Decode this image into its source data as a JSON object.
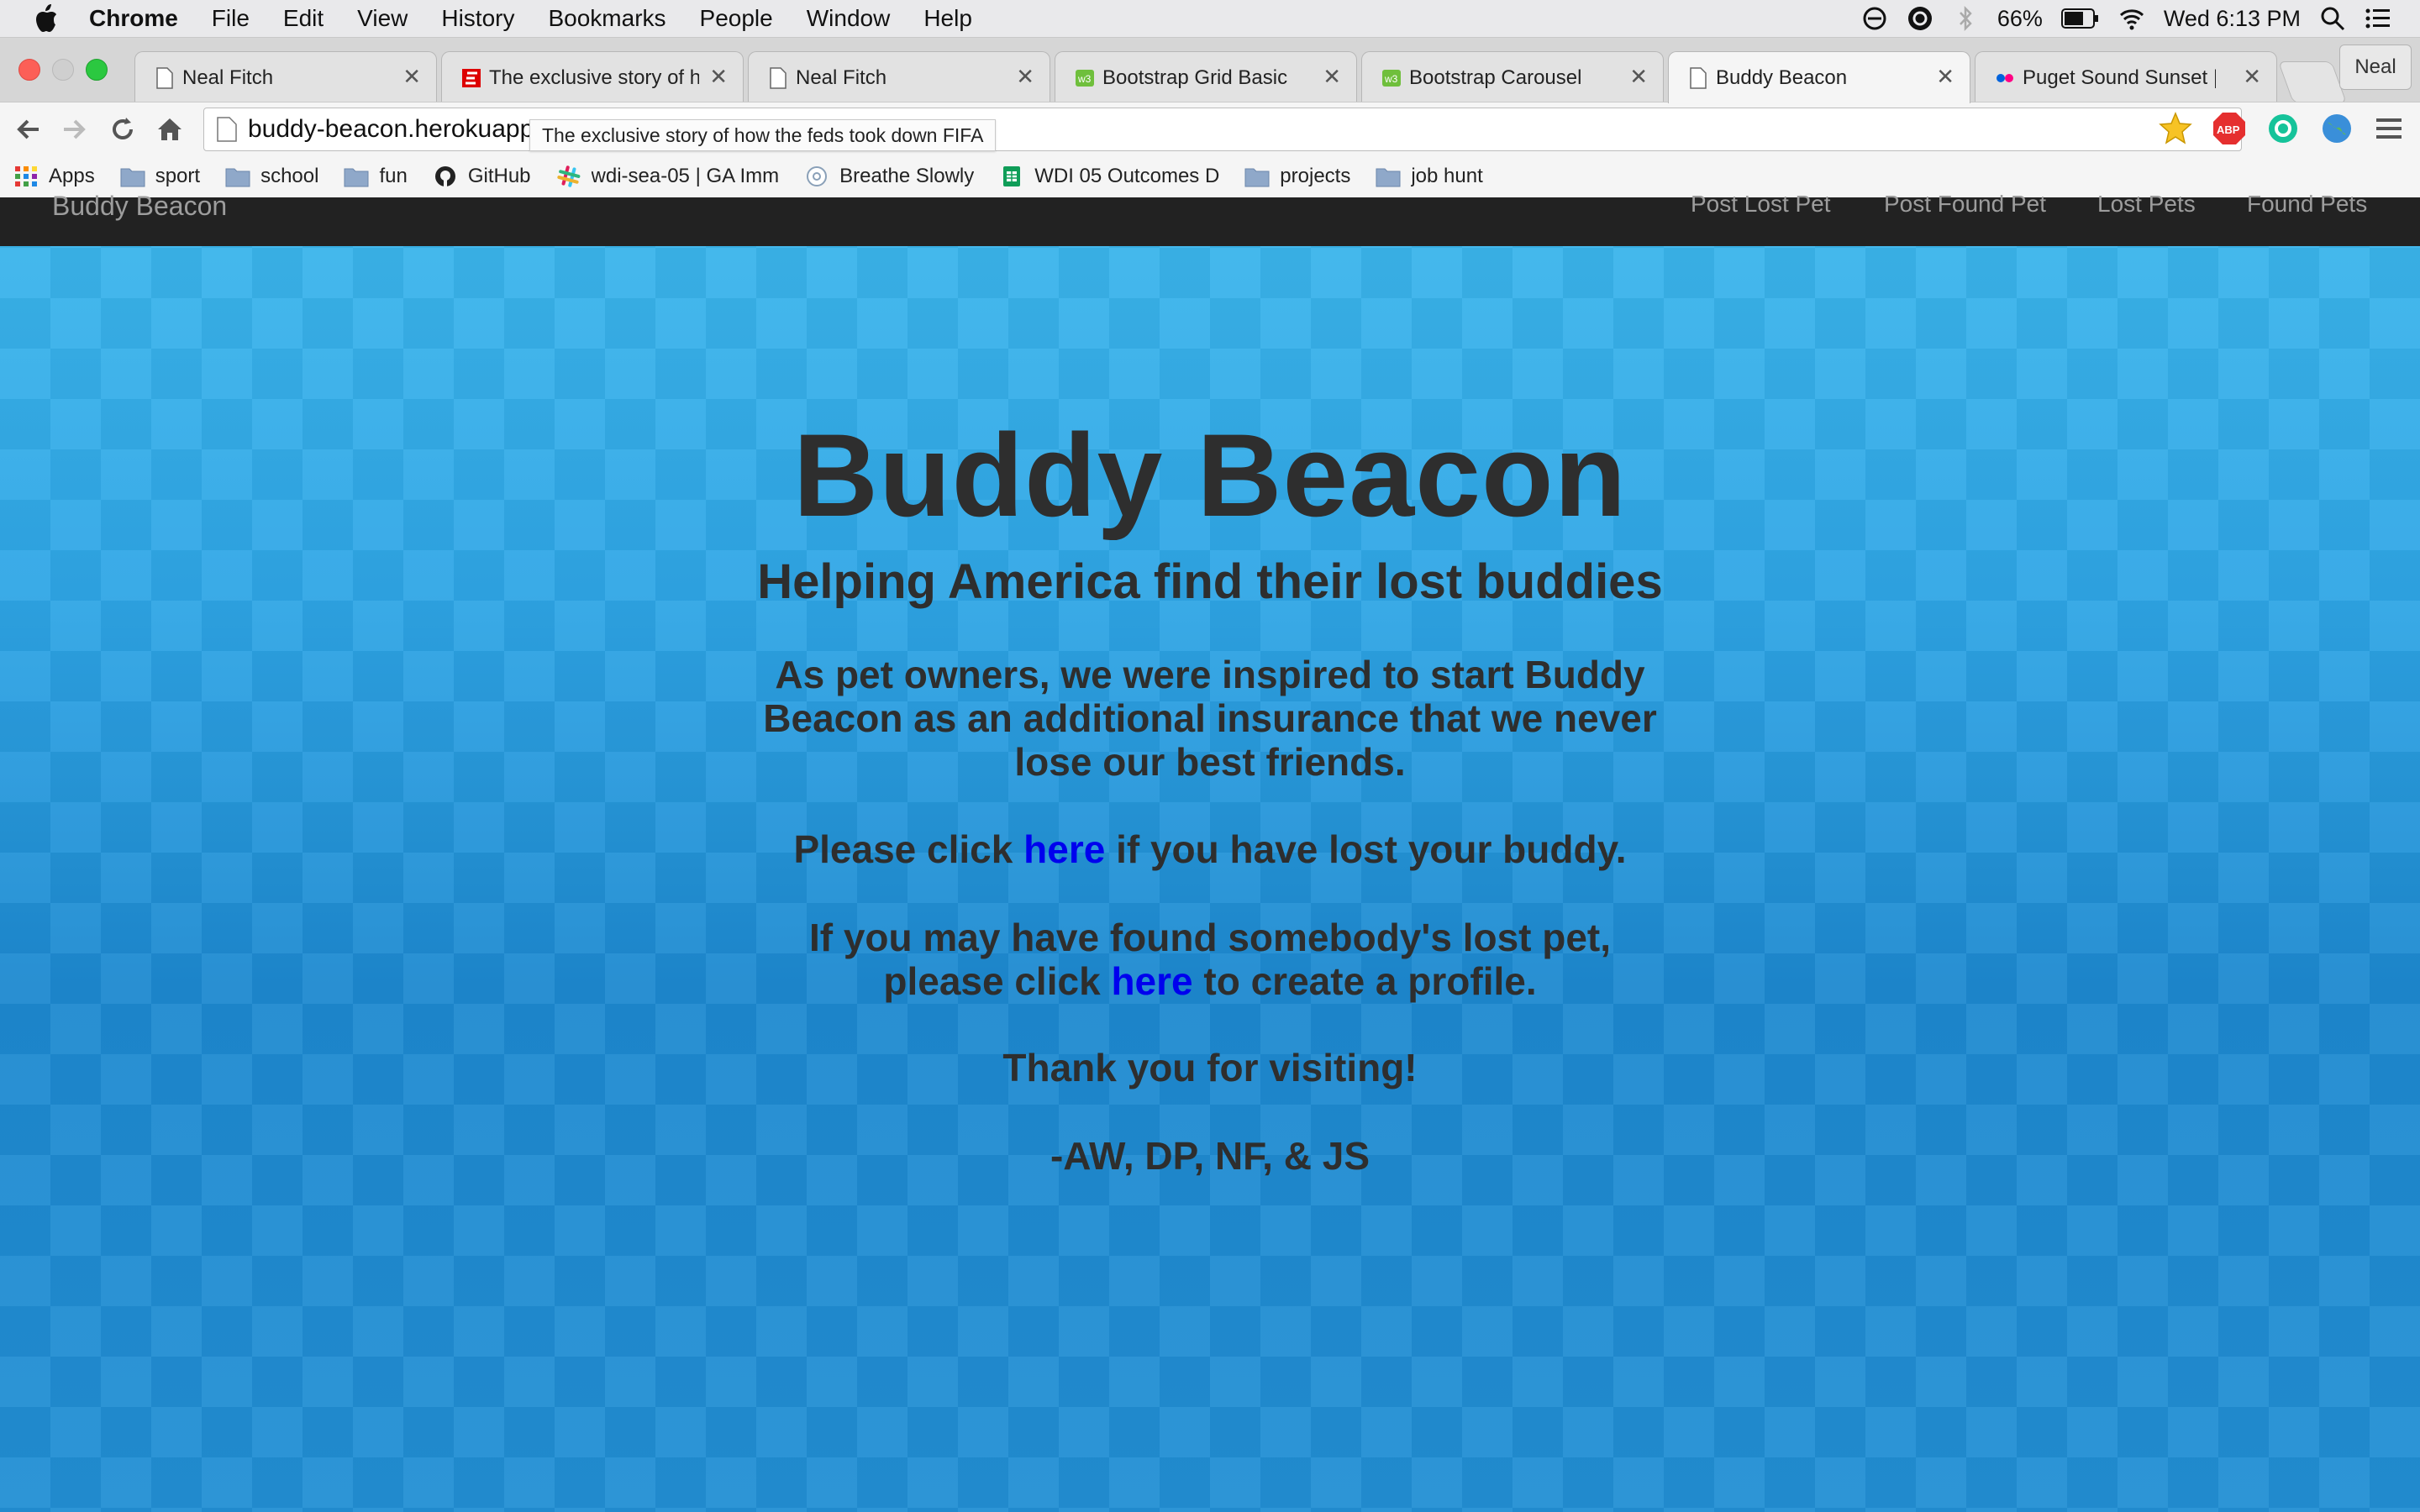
{
  "menubar": {
    "app_name": "Chrome",
    "items": [
      "File",
      "Edit",
      "View",
      "History",
      "Bookmarks",
      "People",
      "Window",
      "Help"
    ],
    "battery": "66%",
    "clock": "Wed 6:13 PM"
  },
  "tabs": [
    {
      "title": "Neal Fitch",
      "icon": "page-icon"
    },
    {
      "title": "The exclusive story of how the feds took down FIFA",
      "icon": "espn-icon"
    },
    {
      "title": "Neal Fitch",
      "icon": "page-icon"
    },
    {
      "title": "Bootstrap Grid Basic",
      "icon": "w3-icon"
    },
    {
      "title": "Bootstrap Carousel",
      "icon": "w3-icon"
    },
    {
      "title": "Buddy Beacon",
      "icon": "page-icon",
      "active": true
    },
    {
      "title": "Puget Sound Sunset | Flickr",
      "icon": "flickr-icon"
    }
  ],
  "profile": "Neal",
  "toolbar": {
    "url": "buddy-beacon.herokuapp",
    "tooltip": "The exclusive story of how the feds took down FIFA"
  },
  "bookmarks": [
    {
      "label": "Apps",
      "icon": "apps-grid-icon"
    },
    {
      "label": "sport",
      "icon": "folder-icon"
    },
    {
      "label": "school",
      "icon": "folder-icon"
    },
    {
      "label": "fun",
      "icon": "folder-icon"
    },
    {
      "label": "GitHub",
      "icon": "github-icon"
    },
    {
      "label": "wdi-sea-05 | GA Imm",
      "icon": "slack-icon"
    },
    {
      "label": "Breathe Slowly",
      "icon": "globe-icon"
    },
    {
      "label": "WDI 05 Outcomes D",
      "icon": "sheets-icon"
    },
    {
      "label": "projects",
      "icon": "folder-icon"
    },
    {
      "label": "job hunt",
      "icon": "folder-icon"
    }
  ],
  "site": {
    "brand": "Buddy Beacon",
    "nav": [
      "Post Lost Pet",
      "Post Found Pet",
      "Lost Pets",
      "Found Pets"
    ],
    "title": "Buddy Beacon",
    "subtitle": "Helping America find their lost buddies",
    "intro_1": "As pet owners, we were inspired to start Buddy",
    "intro_2": "Beacon as an additional insurance that we never",
    "intro_3": "lose our best friends.",
    "lost_pre": "Please click ",
    "lost_link": "here",
    "lost_post": " if you have lost your buddy.",
    "found_1": "If you may have found somebody's lost pet,",
    "found_pre": "please click ",
    "found_link": "here",
    "found_post": " to create a profile.",
    "thanks": "Thank you for visiting!",
    "signoff": "-AW, DP, NF, & JS"
  },
  "colors": {
    "link": "#0000ee",
    "navbar": "#222222",
    "text": "#2e2e2e"
  }
}
